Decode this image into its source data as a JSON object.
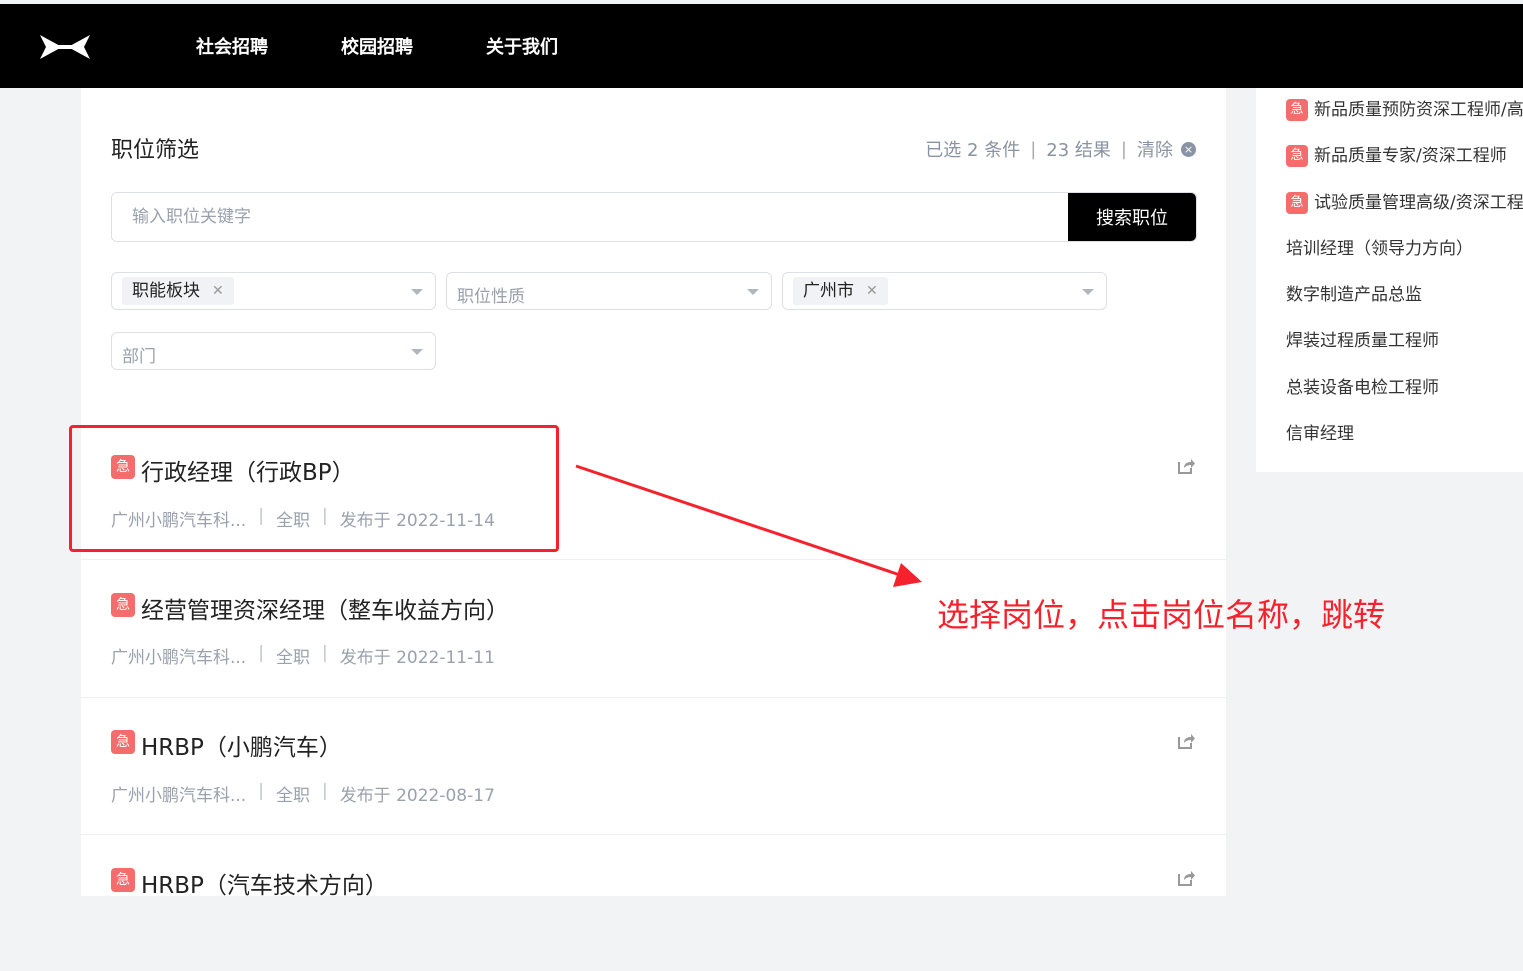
{
  "nav": {
    "items": [
      "社会招聘",
      "校园招聘",
      "关于我们"
    ]
  },
  "filter": {
    "title": "职位筛选",
    "summary": {
      "selected": "已选 2 条件",
      "results": "23 结果",
      "clear": "清除"
    },
    "search": {
      "placeholder": "输入职位关键字",
      "button": "搜索职位"
    },
    "selects": [
      {
        "tag": "职能板块",
        "placeholder": ""
      },
      {
        "tag": "",
        "placeholder": "职位性质"
      },
      {
        "tag": "广州市",
        "placeholder": ""
      },
      {
        "tag": "",
        "placeholder": "部门"
      }
    ]
  },
  "jobs": [
    {
      "badge": "急",
      "title": "行政经理（行政BP）",
      "company": "广州小鹏汽车科...",
      "type": "全职",
      "date": "发布于 2022-11-14"
    },
    {
      "badge": "急",
      "title": "经营管理资深经理（整车收益方向）",
      "company": "广州小鹏汽车科...",
      "type": "全职",
      "date": "发布于 2022-11-11"
    },
    {
      "badge": "急",
      "title": "HRBP（小鹏汽车）",
      "company": "广州小鹏汽车科...",
      "type": "全职",
      "date": "发布于 2022-08-17"
    },
    {
      "badge": "急",
      "title": "HRBP（汽车技术方向）",
      "company": "",
      "type": "",
      "date": ""
    }
  ],
  "sidebar": {
    "items": [
      {
        "badge": "急",
        "label": "新品质量预防资深工程师/高"
      },
      {
        "badge": "急",
        "label": "新品质量专家/资深工程师"
      },
      {
        "badge": "急",
        "label": "试验质量管理高级/资深工程"
      },
      {
        "badge": "",
        "label": "培训经理（领导力方向）"
      },
      {
        "badge": "",
        "label": "数字制造产品总监"
      },
      {
        "badge": "",
        "label": "焊装过程质量工程师"
      },
      {
        "badge": "",
        "label": "总装设备电检工程师"
      },
      {
        "badge": "",
        "label": "信审经理"
      }
    ]
  },
  "annotation": {
    "text": "选择岗位，点击岗位名称，跳转",
    "color": "#f5222d"
  },
  "colors": {
    "badge": "#f56c6c",
    "header": "#000000",
    "accent": "#f5222d"
  }
}
